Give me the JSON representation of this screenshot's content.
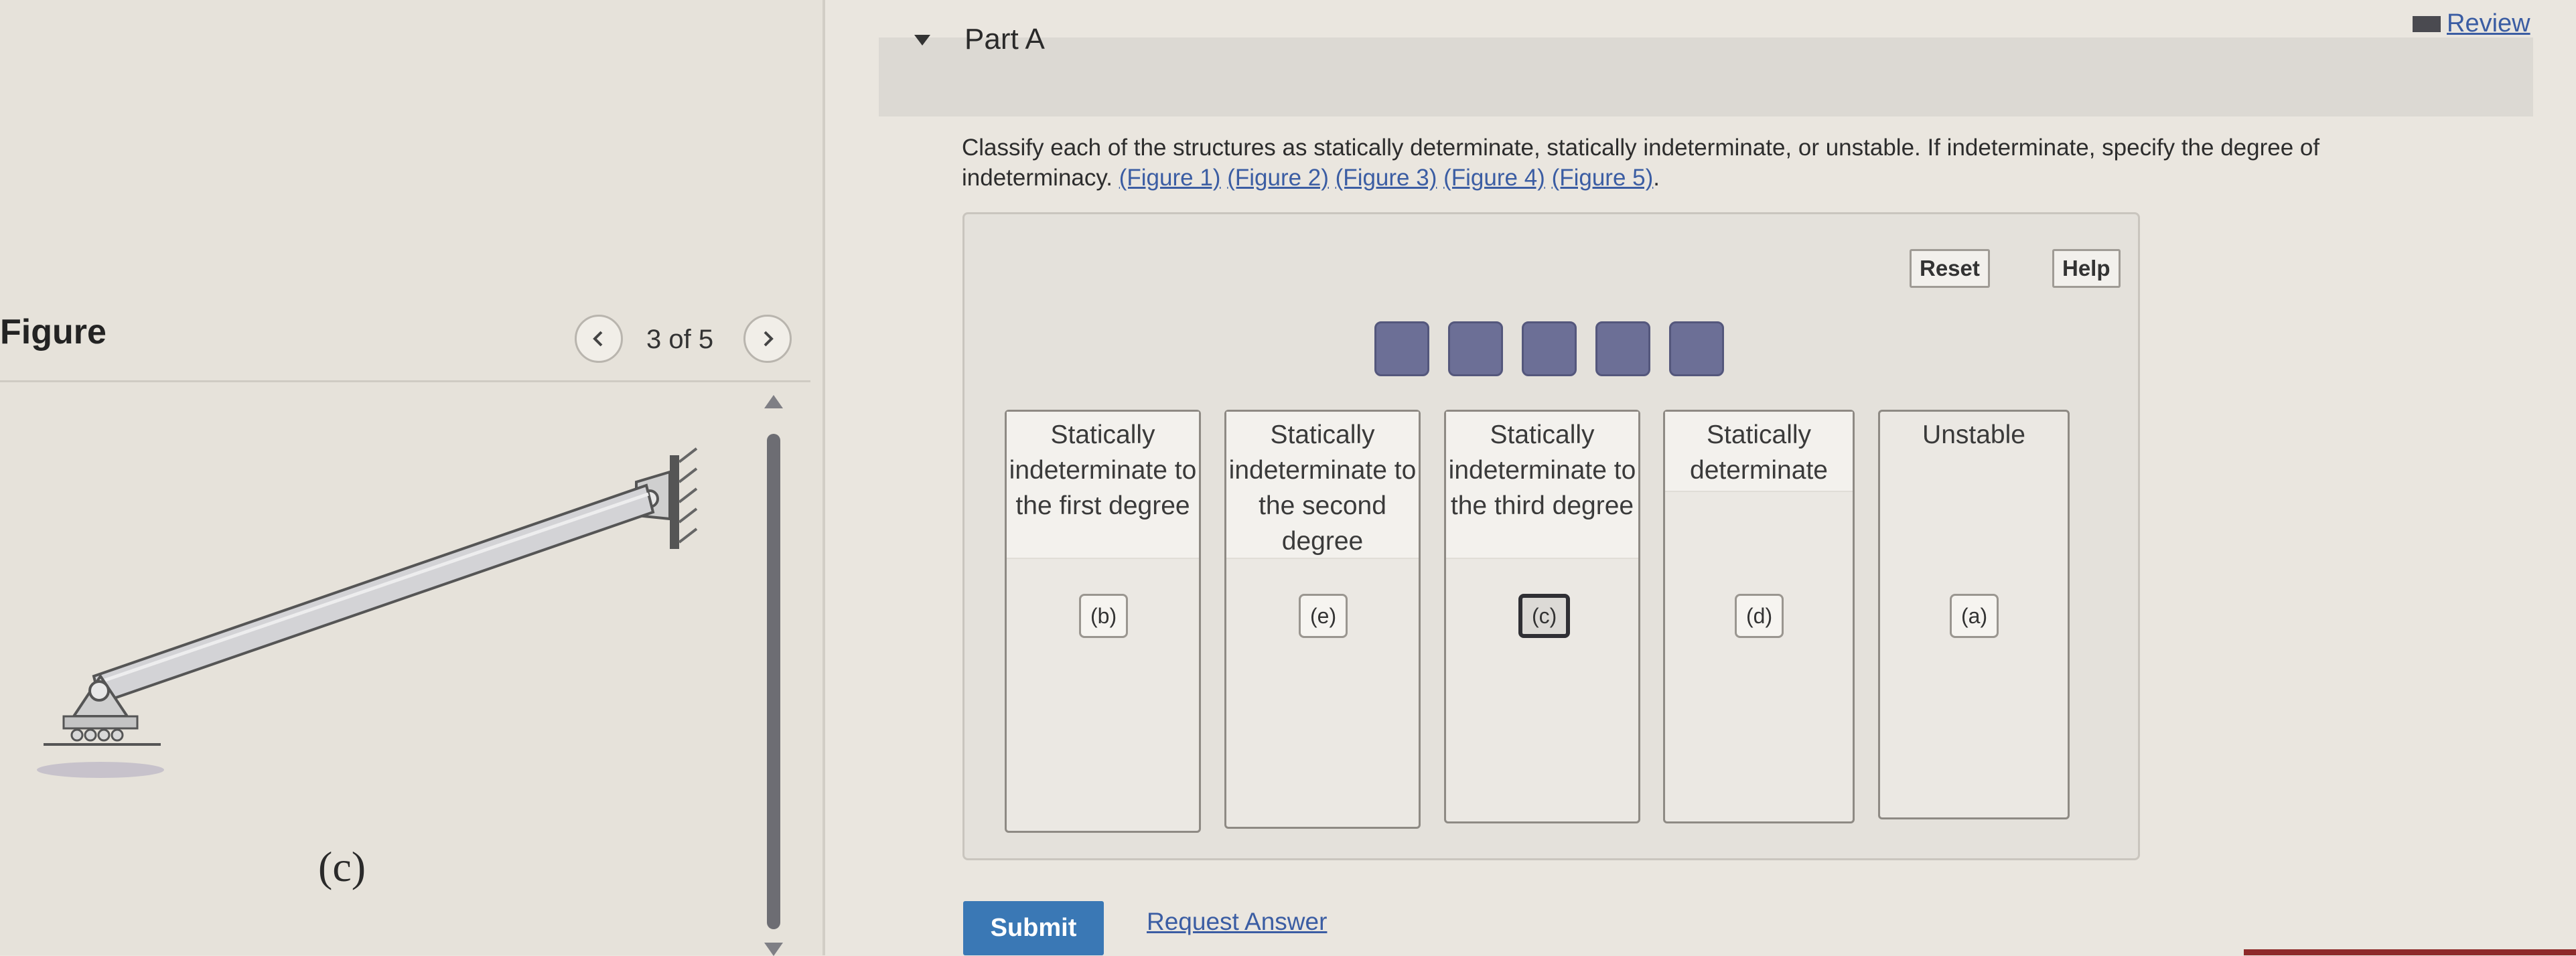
{
  "header": {
    "review_label": "Review",
    "part_title": "Part A"
  },
  "question": {
    "text": "Classify each of the structures as statically determinate, statically indeterminate, or unstable. If indeterminate, specify the degree of indeterminacy.",
    "figure_links": [
      "(Figure 1)",
      "(Figure 2)",
      "(Figure 3)",
      "(Figure 4)",
      "(Figure 5)"
    ],
    "end": "."
  },
  "toolbar": {
    "reset_label": "Reset",
    "help_label": "Help"
  },
  "bins": [
    {
      "label": "Statically indeterminate to the first degree",
      "items": [
        "(b)"
      ]
    },
    {
      "label": "Statically indeterminate to the second degree",
      "items": [
        "(e)"
      ]
    },
    {
      "label": "Statically indeterminate to the third degree",
      "items": [
        "(c)"
      ]
    },
    {
      "label": "Statically determinate",
      "items": [
        "(d)"
      ]
    },
    {
      "label": "Unstable",
      "items": [
        "(a)"
      ]
    }
  ],
  "figure": {
    "title": "Figure",
    "counter": "3 of 5",
    "caption": "(c)"
  },
  "actions": {
    "submit_label": "Submit",
    "request_answer_label": "Request Answer"
  },
  "colors": {
    "link": "#3b5da3",
    "submit": "#3a78b5",
    "token": "#6c6f96"
  }
}
